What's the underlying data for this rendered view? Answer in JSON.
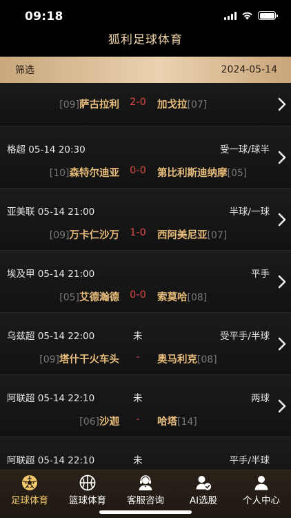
{
  "status": {
    "time": "09:18"
  },
  "app": {
    "title": "狐利足球体育"
  },
  "filter": {
    "label": "筛选",
    "date": "2024-05-14"
  },
  "matches": [
    {
      "league": "",
      "state": "",
      "odds": "",
      "home_rank": "[09]",
      "home": "萨古拉利",
      "score": "2-0",
      "away": "加戈拉",
      "away_rank": "[07]"
    },
    {
      "league": "格超  05-14 20:30",
      "state": "",
      "odds": "受一球/球半",
      "home_rank": "[10]",
      "home": "森特尔迪亚",
      "score": "0-0",
      "away": "第比利斯迪纳摩",
      "away_rank": "[05]"
    },
    {
      "league": "亚美联  05-14 21:00",
      "state": "",
      "odds": "半球/一球",
      "home_rank": "[09]",
      "home": "万卡仁沙万",
      "score": "1-0",
      "away": "西阿美尼亚",
      "away_rank": "[07]"
    },
    {
      "league": "埃及甲  05-14 21:00",
      "state": "",
      "odds": "平手",
      "home_rank": "[05]",
      "home": "艾德瀚德",
      "score": "0-0",
      "away": "索莫哈",
      "away_rank": "[08]"
    },
    {
      "league": "乌兹超  05-14 22:00",
      "state": "未",
      "odds": "受平手/半球",
      "home_rank": "[09]",
      "home": "塔什干火车头",
      "score": "-",
      "away": "奥马利克",
      "away_rank": "[08]"
    },
    {
      "league": "阿联超  05-14 22:10",
      "state": "未",
      "odds": "两球",
      "home_rank": "[06]",
      "home": "沙迦",
      "score": "-",
      "away": "哈塔",
      "away_rank": "[14]"
    },
    {
      "league": "阿联超  05-14 22:10",
      "state": "未",
      "odds": "平手/半球",
      "home_rank": "",
      "home": "",
      "score": "",
      "away": "",
      "away_rank": ""
    }
  ],
  "tabs": [
    {
      "label": "足球体育",
      "icon": "soccer-ball-icon",
      "active": true
    },
    {
      "label": "篮球体育",
      "icon": "basketball-icon",
      "active": false
    },
    {
      "label": "客服咨询",
      "icon": "customer-service-icon",
      "active": false
    },
    {
      "label": "AI选股",
      "icon": "ai-user-check-icon",
      "active": false
    },
    {
      "label": "个人中心",
      "icon": "person-icon",
      "active": false
    }
  ],
  "colors": {
    "accent_gold": "#e8bc7a",
    "score_red": "#e04848",
    "tab_active": "#f3c86a",
    "filter_bar": "#ebd2b0"
  }
}
